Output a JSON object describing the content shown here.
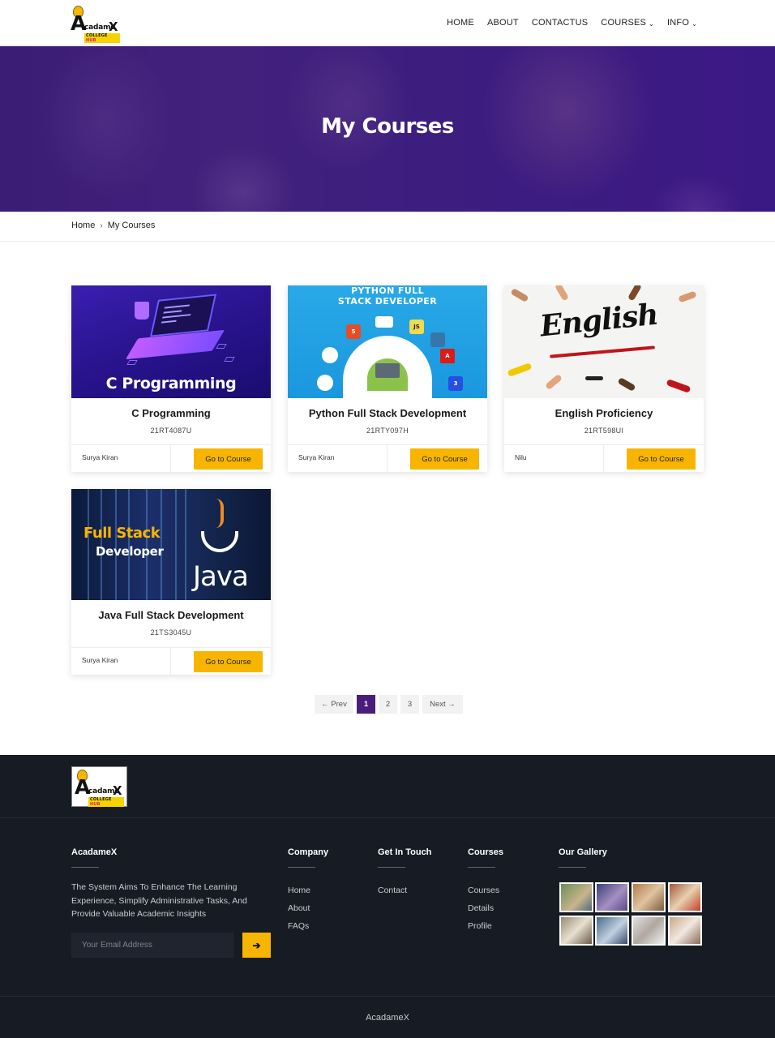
{
  "brand": {
    "logo_initial": "A",
    "logo_word": "cadame",
    "logo_final": "X",
    "logo_tagline_a": "COLLEGE",
    "logo_tagline_b": "HUB"
  },
  "nav": {
    "items": [
      {
        "label": "HOME"
      },
      {
        "label": "ABOUT"
      },
      {
        "label": "CONTACTUS"
      },
      {
        "label": "COURSES",
        "dropdown": true
      },
      {
        "label": "INFO",
        "dropdown": true
      }
    ],
    "chevron": "⌄"
  },
  "hero": {
    "title": "My Courses"
  },
  "breadcrumb": {
    "home": "Home",
    "separator": "›",
    "current": "My Courses"
  },
  "courses": [
    {
      "thumb_label": "C Programming",
      "title": "C Programming",
      "code": "21RT4087U",
      "author": "Surya Kiran",
      "button": "Go to Course"
    },
    {
      "thumb_label_1": "PYTHON FULL",
      "thumb_label_2": "STACK DEVELOPER",
      "title": "Python Full Stack Development",
      "code": "21RTY097H",
      "author": "Surya Kiran",
      "button": "Go to Course"
    },
    {
      "thumb_label": "English",
      "title": "English Proficiency",
      "code": "21RT598UI",
      "author": "Nilu",
      "button": "Go to Course"
    },
    {
      "thumb_label_1": "Full Stack",
      "thumb_label_2": "Developer",
      "thumb_label_3": "Java",
      "title": "Java Full Stack Development",
      "code": "21TS3045U",
      "author": "Surya Kiran",
      "button": "Go to Course"
    }
  ],
  "pagination": {
    "prev": "← Prev",
    "pages": [
      "1",
      "2",
      "3"
    ],
    "active": "1",
    "next": "Next →"
  },
  "footer": {
    "about_title": "AcadameX",
    "about_text": "The System Aims To Enhance The Learning Experience, Simplify Administrative Tasks, And Provide Valuable Academic Insights",
    "email_placeholder": "Your Email Address",
    "send_icon": "➔",
    "company_title": "Company",
    "company_links": [
      "Home",
      "About",
      "FAQs"
    ],
    "touch_title": "Get In Touch",
    "touch_links": [
      "Contact"
    ],
    "courses_title": "Courses",
    "courses_links": [
      "Courses",
      "Details",
      "Profile"
    ],
    "gallery_title": "Our Gallery",
    "copyright": "AcadameX"
  },
  "colors": {
    "accent": "#f7b500",
    "brand_purple": "#4a1d7a",
    "footer_bg": "#171c24"
  }
}
